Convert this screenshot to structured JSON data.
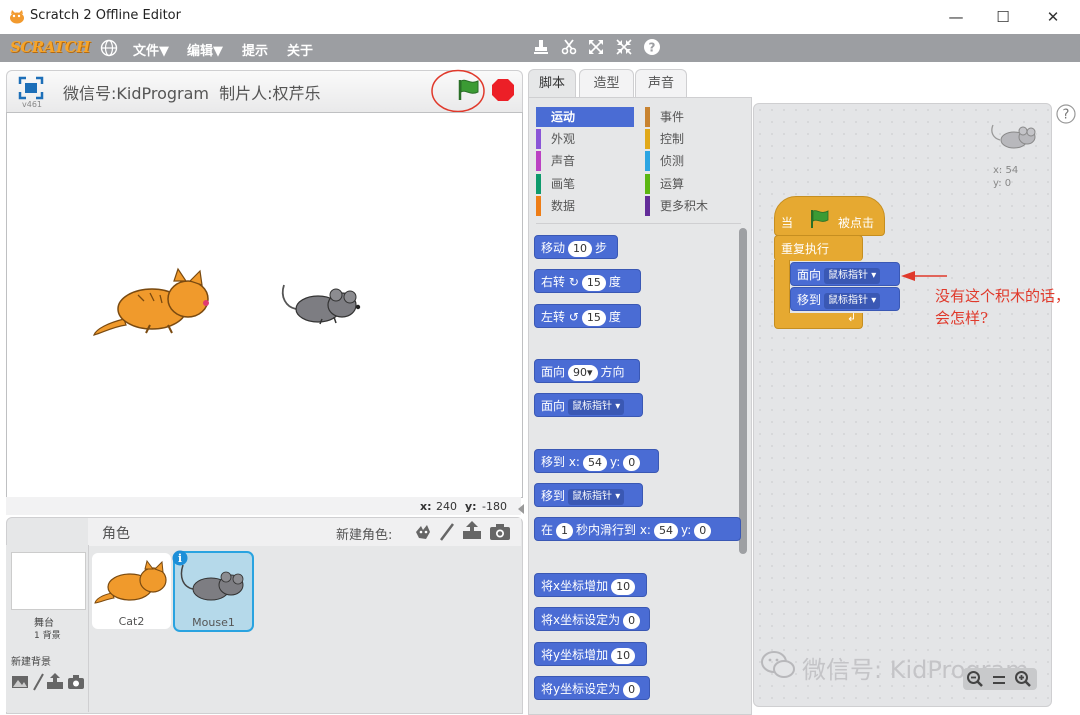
{
  "window": {
    "title": "Scratch 2 Offline Editor",
    "minimize": "—",
    "maximize": "☐",
    "close": "✕"
  },
  "menu": {
    "logo": "SCRATCH",
    "file": "文件▼",
    "edit": "编辑▼",
    "tips": "提示",
    "about": "关于"
  },
  "stage": {
    "version": "v461",
    "header_text": "微信号:KidProgram  制片人:权芹乐",
    "run_annotation": "运行",
    "coords_x_label": "x:",
    "coords_x": "240",
    "coords_y_label": "y:",
    "coords_y": "-180"
  },
  "sprites": {
    "header": "角色",
    "new_sprite": "新建角色:",
    "stage_label": "舞台",
    "stage_bg_count": "1 背景",
    "new_backdrop": "新建背景",
    "items": [
      {
        "name": "Cat2"
      },
      {
        "name": "Mouse1"
      }
    ]
  },
  "tabs": [
    "脚本",
    "造型",
    "声音"
  ],
  "categories": [
    {
      "label": "运动",
      "color": "#4a6cd4"
    },
    {
      "label": "事件",
      "color": "#c88330"
    },
    {
      "label": "外观",
      "color": "#8a55d7"
    },
    {
      "label": "控制",
      "color": "#e1a91a"
    },
    {
      "label": "声音",
      "color": "#bb42c3"
    },
    {
      "label": "侦测",
      "color": "#2ca5e2"
    },
    {
      "label": "画笔",
      "color": "#0e9a6c"
    },
    {
      "label": "运算",
      "color": "#5cb712"
    },
    {
      "label": "数据",
      "color": "#ee7d16"
    },
    {
      "label": "更多积木",
      "color": "#632d99"
    }
  ],
  "blocks": {
    "move": "移动",
    "move_val": "10",
    "move_unit": "步",
    "turn_right": "右转",
    "turn_right_val": "15",
    "turn_right_unit": "度",
    "turn_left": "左转",
    "turn_left_val": "15",
    "turn_left_unit": "度",
    "point_dir": "面向",
    "point_dir_val": "90▾",
    "point_dir_unit": "方向",
    "point_towards": "面向",
    "point_towards_val": "鼠标指针",
    "goto_xy": "移到 x:",
    "goto_x": "54",
    "goto_y_label": "y:",
    "goto_y": "0",
    "goto": "移到",
    "goto_val": "鼠标指针",
    "glide": "在",
    "glide_secs": "1",
    "glide_mid": "秒内滑行到 x:",
    "glide_x": "54",
    "glide_y_label": "y:",
    "glide_y": "0",
    "change_x": "将x坐标增加",
    "change_x_val": "10",
    "set_x": "将x坐标设定为",
    "set_x_val": "0",
    "change_y": "将y坐标增加",
    "change_y_val": "10",
    "set_y": "将y坐标设定为",
    "set_y_val": "0"
  },
  "script": {
    "sprite_x": "x: 54",
    "sprite_y": "y: 0",
    "hat_when": "当",
    "hat_clicked": "被点击",
    "forever": "重复执行",
    "point_towards": "面向",
    "point_towards_val": "鼠标指针",
    "goto": "移到",
    "goto_val": "鼠标指针",
    "annotation": "没有这个积木的话，会怎样?",
    "help": "?"
  },
  "watermark": "微信号: KidProgram",
  "colors": {
    "motion": "#4a6cd4",
    "control": "#e6a931",
    "menubar": "#9c9ea2",
    "annotation": "#e0392b",
    "stop": "#ec1f27",
    "flag": "#2f8e2a"
  }
}
